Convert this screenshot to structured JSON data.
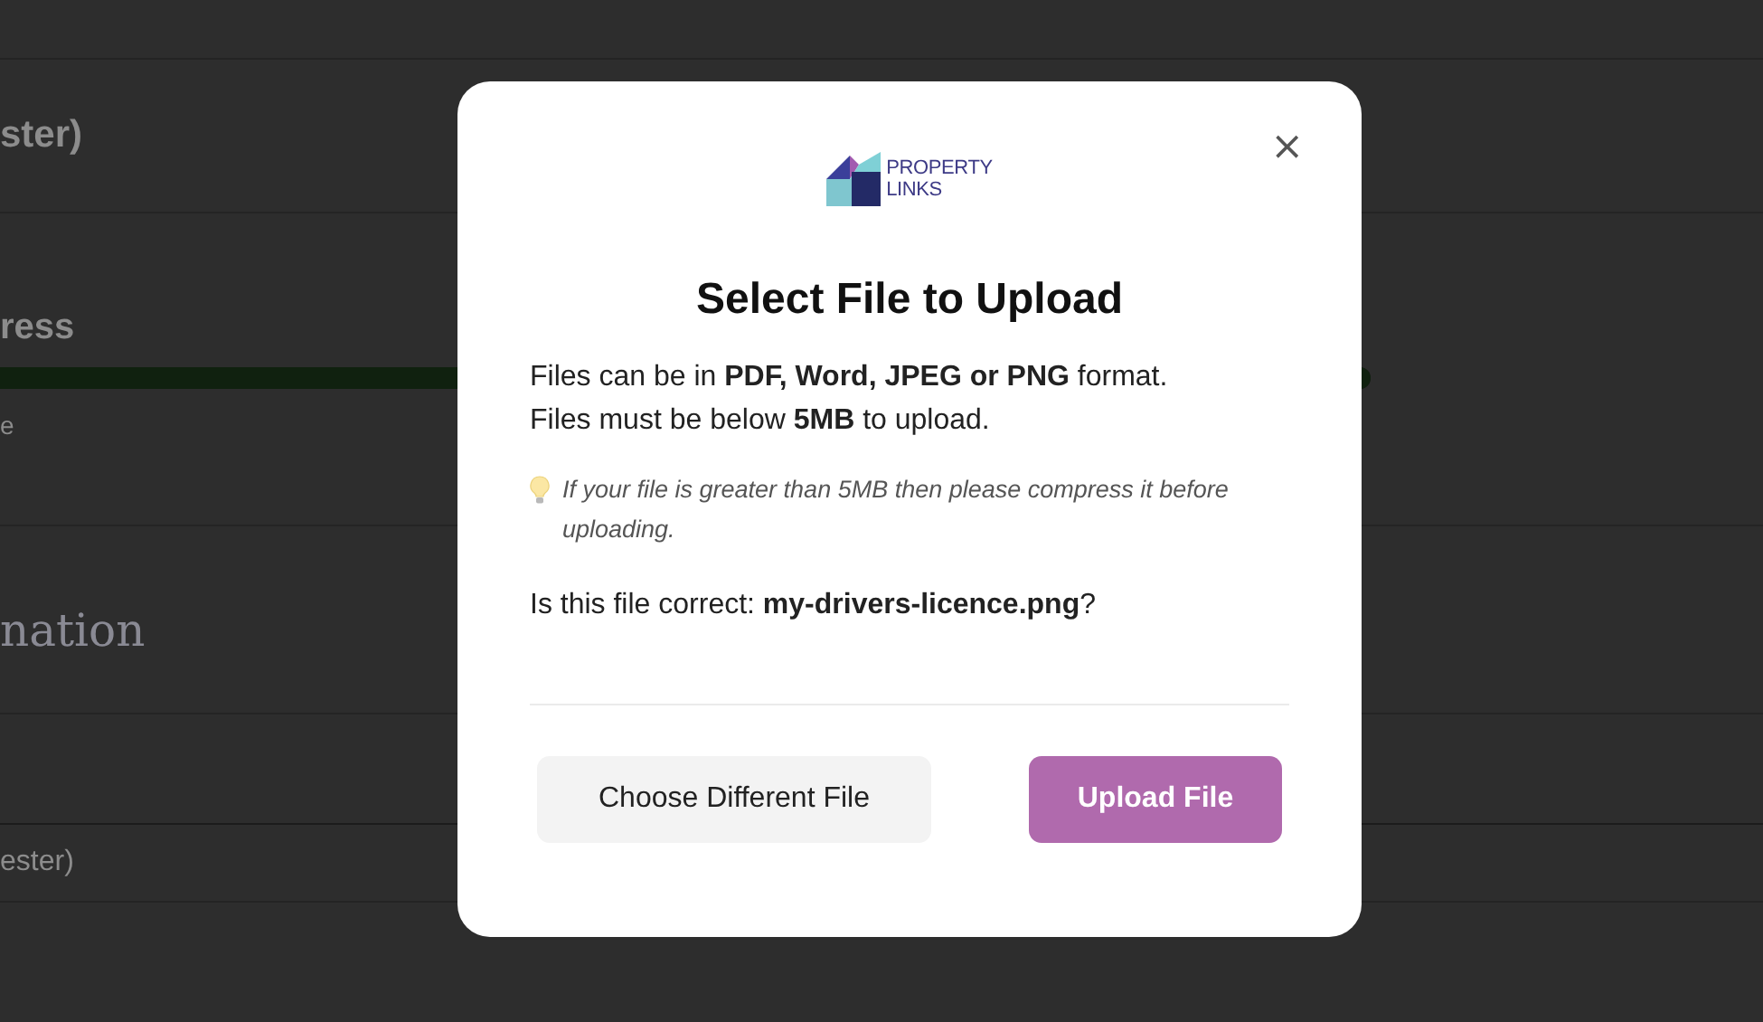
{
  "background_page": {
    "rows": [
      {
        "kind": "heading",
        "text": "ster)"
      },
      {
        "kind": "progress",
        "title": "ress",
        "level": 1,
        "caption": "e"
      },
      {
        "kind": "section",
        "text": "nation"
      },
      {
        "kind": "blank"
      },
      {
        "kind": "item",
        "text": "ester)"
      },
      {
        "kind": "blank"
      }
    ]
  },
  "dialog": {
    "logo": {
      "line_1": "PROPERTY",
      "line_2": "LINKS"
    },
    "close": "×",
    "title": "Select File to Upload",
    "info": [
      "Files can be in **PDF, Word, JPEG or PNG** format.",
      "Files must be below **5MB** to upload."
    ],
    "tip": "If your file is greater than 5MB then please compress it before uploading.",
    "confirm": "Is this file correct: **my-drivers-licence.png**?",
    "buttons": [
      {
        "kind": "secondary",
        "label": "Choose Different File"
      },
      {
        "kind": "primary",
        "label": "Upload File"
      }
    ]
  }
}
